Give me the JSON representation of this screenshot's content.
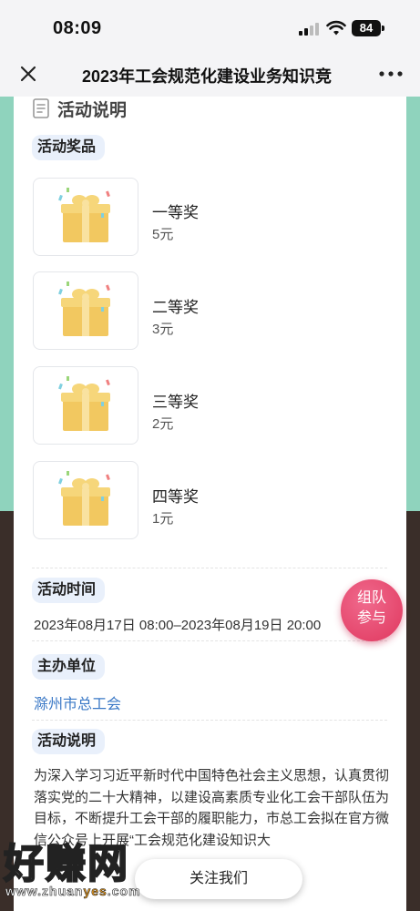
{
  "status_bar": {
    "time": "08:09",
    "battery": "84"
  },
  "nav": {
    "title": "2023年工会规范化建设业务知识竞"
  },
  "header": {
    "title": "活动说明"
  },
  "sections": {
    "prizes": "活动奖品",
    "time": "活动时间",
    "organizer": "主办单位",
    "description": "活动说明"
  },
  "prizes": [
    {
      "name": "一等奖",
      "value": "5元"
    },
    {
      "name": "二等奖",
      "value": "3元"
    },
    {
      "name": "三等奖",
      "value": "2元"
    },
    {
      "name": "四等奖",
      "value": "1元"
    }
  ],
  "activity_time": "2023年08月17日 08:00–2023年08月19日 20:00",
  "organizer": "滁州市总工会",
  "description": "为深入学习习近平新时代中国特色社会主义思想，认真贯彻落实党的二十大精神，以建设高素质专业化工会干部队伍为目标，不断提升工会干部的履职能力，市总工会拟在官方微信公众号上开展“工会规范化建设知识大",
  "float_button": {
    "line1": "组队",
    "line2": "参与"
  },
  "follow_button": "关注我们",
  "watermark": {
    "main": "好赚网",
    "sub_left": "www.zhuan",
    "sub_accent": "yes",
    "sub_right": ".com"
  },
  "colors": {
    "mint": "#8fd3bd",
    "brown": "#3a2e29",
    "link": "#3a78c6",
    "float_button": "#e0375e"
  }
}
